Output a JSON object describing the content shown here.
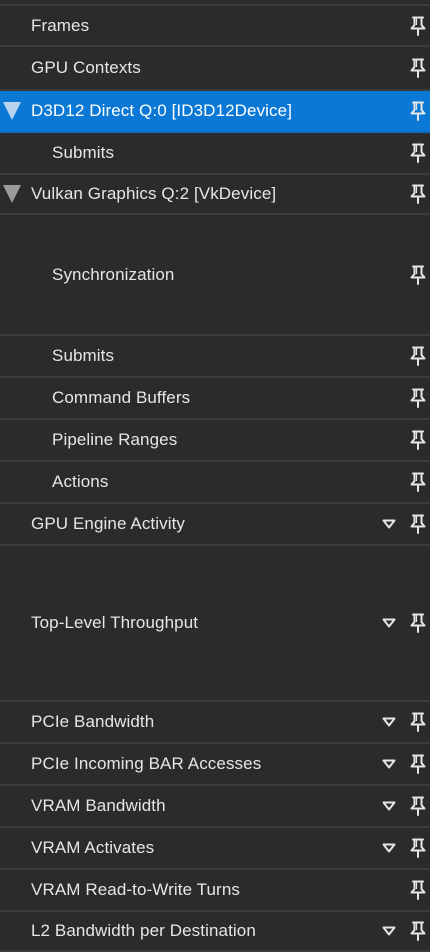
{
  "panel": {
    "colors": {
      "background": "#2b2b2b",
      "selected": "#0a78d4",
      "text": "#e6e6e6",
      "divider": "#3b3b3b"
    },
    "rows": [
      {
        "label": "Frames",
        "level": 0,
        "has_expander": false,
        "has_caret": false,
        "selected": false
      },
      {
        "label": "GPU Contexts",
        "level": 0,
        "has_expander": false,
        "has_caret": false,
        "selected": false
      },
      {
        "label": "D3D12 Direct Q:0 [ID3D12Device]",
        "level": 0,
        "has_expander": true,
        "has_caret": false,
        "selected": true
      },
      {
        "label": "Submits",
        "level": 1,
        "has_expander": false,
        "has_caret": false,
        "selected": false
      },
      {
        "label": "Vulkan Graphics Q:2 [VkDevice]",
        "level": 0,
        "has_expander": true,
        "has_caret": false,
        "selected": false
      },
      {
        "label": "Synchronization",
        "level": 1,
        "has_expander": false,
        "has_caret": false,
        "selected": false
      },
      {
        "label": "Submits",
        "level": 1,
        "has_expander": false,
        "has_caret": false,
        "selected": false
      },
      {
        "label": "Command Buffers",
        "level": 1,
        "has_expander": false,
        "has_caret": false,
        "selected": false
      },
      {
        "label": "Pipeline Ranges",
        "level": 1,
        "has_expander": false,
        "has_caret": false,
        "selected": false
      },
      {
        "label": "Actions",
        "level": 1,
        "has_expander": false,
        "has_caret": false,
        "selected": false
      },
      {
        "label": "GPU Engine Activity",
        "level": 0,
        "has_expander": false,
        "has_caret": true,
        "selected": false
      },
      {
        "label": "Top-Level Throughput",
        "level": 0,
        "has_expander": false,
        "has_caret": true,
        "selected": false
      },
      {
        "label": "PCIe Bandwidth",
        "level": 0,
        "has_expander": false,
        "has_caret": true,
        "selected": false
      },
      {
        "label": "PCIe Incoming BAR Accesses",
        "level": 0,
        "has_expander": false,
        "has_caret": true,
        "selected": false
      },
      {
        "label": "VRAM Bandwidth",
        "level": 0,
        "has_expander": false,
        "has_caret": true,
        "selected": false
      },
      {
        "label": "VRAM Activates",
        "level": 0,
        "has_expander": false,
        "has_caret": true,
        "selected": false
      },
      {
        "label": "VRAM Read-to-Write Turns",
        "level": 0,
        "has_expander": false,
        "has_caret": false,
        "selected": false
      },
      {
        "label": "L2 Bandwidth per Destination",
        "level": 0,
        "has_expander": false,
        "has_caret": true,
        "selected": false
      }
    ]
  }
}
